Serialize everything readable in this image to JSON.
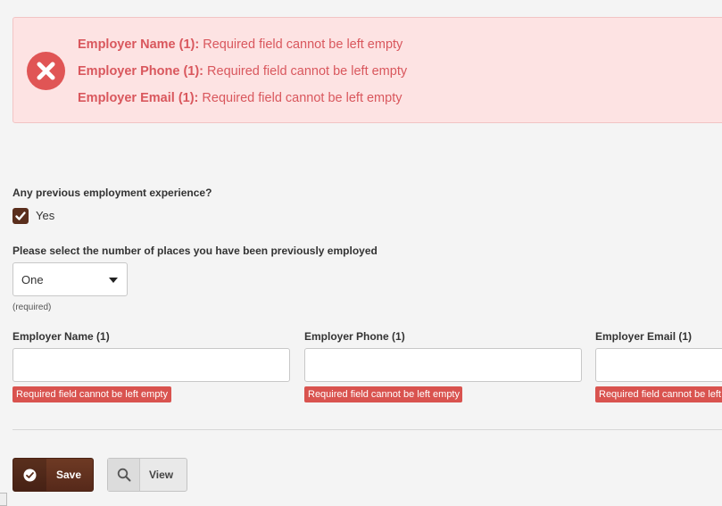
{
  "errors": {
    "icon": "close-circle-icon",
    "color": "#d9575d",
    "items": [
      {
        "field": "Employer Name (1):",
        "message": "Required field cannot be left empty"
      },
      {
        "field": "Employer Phone (1):",
        "message": "Required field cannot be left empty"
      },
      {
        "field": "Employer Email (1):",
        "message": "Required field cannot be left empty"
      }
    ]
  },
  "experience": {
    "question": "Any previous employment experience?",
    "checkbox_label": "Yes",
    "checked": true
  },
  "places": {
    "question": "Please select the number of places you have been previously employed",
    "selected": "One",
    "hint": "(required)"
  },
  "fields": [
    {
      "label": "Employer Name (1)",
      "value": "",
      "error": "Required field cannot be left empty"
    },
    {
      "label": "Employer Phone (1)",
      "value": "",
      "error": "Required field cannot be left empty"
    },
    {
      "label": "Employer Email (1)",
      "value": "",
      "error": "Required field cannot be left empty"
    }
  ],
  "actions": {
    "save_label": "Save",
    "save_icon": "check-circle-icon",
    "view_label": "View",
    "view_icon": "search-icon"
  },
  "colors": {
    "brand": "#5a2e1c",
    "error_bg": "#fde3e3",
    "error_badge": "#d9534f"
  }
}
